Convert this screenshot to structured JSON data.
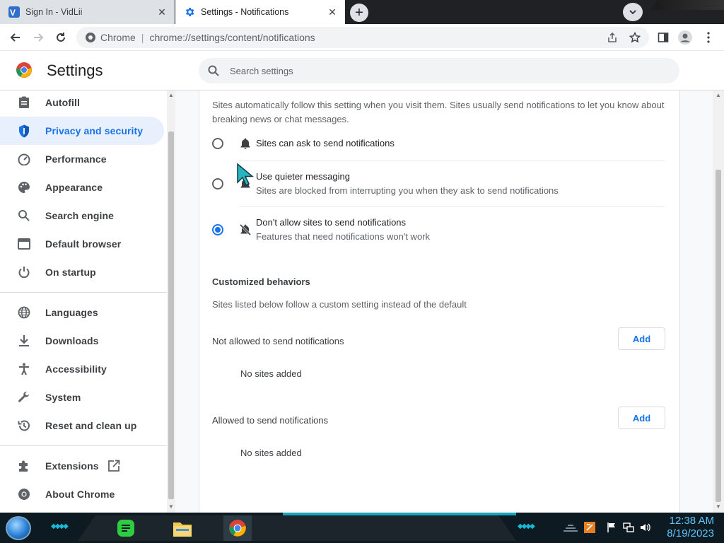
{
  "tabs": [
    {
      "title": "Sign In - VidLii",
      "close": "✕"
    },
    {
      "title": "Settings - Notifications",
      "close": "✕"
    }
  ],
  "omnibox": {
    "site_label": "Chrome",
    "separator": "|",
    "url": "chrome://settings/content/notifications"
  },
  "header": {
    "title": "Settings",
    "search_placeholder": "Search settings"
  },
  "sidebar": {
    "items": [
      {
        "label": "Autofill",
        "icon": "clipboard-icon"
      },
      {
        "label": "Privacy and security",
        "icon": "shield-icon",
        "selected": true
      },
      {
        "label": "Performance",
        "icon": "speedometer-icon"
      },
      {
        "label": "Appearance",
        "icon": "palette-icon"
      },
      {
        "label": "Search engine",
        "icon": "search-icon"
      },
      {
        "label": "Default browser",
        "icon": "browser-icon"
      },
      {
        "label": "On startup",
        "icon": "power-icon"
      },
      {
        "label": "Languages",
        "icon": "globe-icon"
      },
      {
        "label": "Downloads",
        "icon": "download-icon"
      },
      {
        "label": "Accessibility",
        "icon": "accessibility-icon"
      },
      {
        "label": "System",
        "icon": "wrench-icon"
      },
      {
        "label": "Reset and clean up",
        "icon": "history-icon"
      },
      {
        "label": "Extensions",
        "icon": "puzzle-icon"
      },
      {
        "label": "About Chrome",
        "icon": "chrome-icon"
      }
    ]
  },
  "content": {
    "intro": "Sites automatically follow this setting when you visit them. Sites usually send notifications to let you know about breaking news or chat messages.",
    "options": [
      {
        "label": "Sites can ask to send notifications",
        "sub": "",
        "checked": false
      },
      {
        "label": "Use quieter messaging",
        "sub": "Sites are blocked from interrupting you when they ask to send notifications",
        "checked": false
      },
      {
        "label": "Don't allow sites to send notifications",
        "sub": "Features that need notifications won't work",
        "checked": true
      }
    ],
    "custom_heading": "Customized behaviors",
    "custom_sub": "Sites listed below follow a custom setting instead of the default",
    "not_allowed_label": "Not allowed to send notifications",
    "allowed_label": "Allowed to send notifications",
    "add_label": "Add",
    "empty_label": "No sites added"
  },
  "taskbar": {
    "time": "12:38 AM",
    "date": "8/19/2023"
  },
  "colors": {
    "accent": "#1a73e8",
    "selected_bg": "#e8f0fe",
    "taskbar": "#0d1a21",
    "clock": "#5fc6ff"
  }
}
